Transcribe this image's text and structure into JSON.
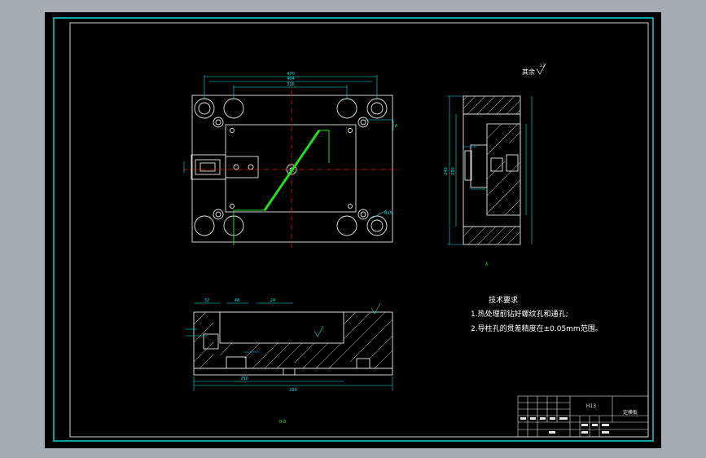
{
  "colors": {
    "background": "#a4acb4",
    "canvas": "#000000",
    "frame": "#00e5e5",
    "part": "#e6e6e6",
    "centerline": "#e02020",
    "section_line": "#22dd22",
    "dimension": "#00e5e5",
    "note_text": "#ffffff"
  },
  "notes": {
    "roughness": "其余",
    "roughness_value": "3.2",
    "title": "技术要求",
    "line1": "1.热处理前钻好螺纹孔和通孔;",
    "line2": "2.导柱孔的贯差精度在±0.05mm范围。"
  },
  "dimensions": {
    "top_overall": "470",
    "top_inner": "404",
    "top_center": "316",
    "front_width": "290",
    "front_depth": "250",
    "front_t1": "32",
    "front_t2": "48",
    "front_t3": "24",
    "side_height": "340",
    "side_h2": "280",
    "radius": "R15"
  },
  "labels": {
    "section_a": "A",
    "section_b": "B",
    "view_a": "A",
    "view_b": "B-B"
  },
  "title_block": {
    "material": "H13",
    "part_name": "定模板"
  }
}
